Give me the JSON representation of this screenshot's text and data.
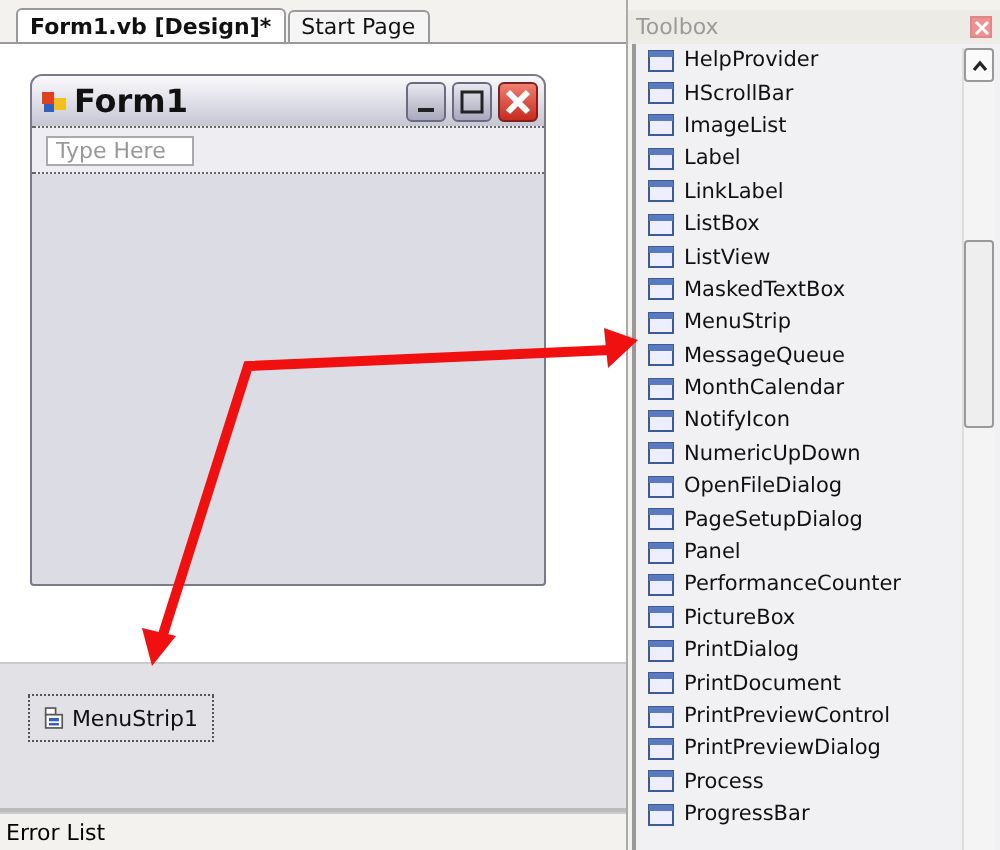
{
  "tabs": [
    {
      "label": "Form1.vb [Design]*",
      "selected": true
    },
    {
      "label": "Start Page",
      "selected": false
    }
  ],
  "form": {
    "title": "Form1",
    "menu_placeholder": "Type Here"
  },
  "tray": {
    "items": [
      "MenuStrip1"
    ]
  },
  "toolbox": {
    "title": "Toolbox",
    "items": [
      {
        "label": "HelpProvider"
      },
      {
        "label": "HScrollBar"
      },
      {
        "label": "ImageList"
      },
      {
        "label": "Label"
      },
      {
        "label": "LinkLabel"
      },
      {
        "label": "ListBox"
      },
      {
        "label": "ListView"
      },
      {
        "label": "MaskedTextBox"
      },
      {
        "label": "MenuStrip"
      },
      {
        "label": "MessageQueue"
      },
      {
        "label": "MonthCalendar"
      },
      {
        "label": "NotifyIcon"
      },
      {
        "label": "NumericUpDown"
      },
      {
        "label": "OpenFileDialog"
      },
      {
        "label": "PageSetupDialog"
      },
      {
        "label": "Panel"
      },
      {
        "label": "PerformanceCounter"
      },
      {
        "label": "PictureBox"
      },
      {
        "label": "PrintDialog"
      },
      {
        "label": "PrintDocument"
      },
      {
        "label": "PrintPreviewControl"
      },
      {
        "label": "PrintPreviewDialog"
      },
      {
        "label": "Process"
      },
      {
        "label": "ProgressBar"
      }
    ]
  },
  "status_bar": {
    "label": "Error List"
  }
}
